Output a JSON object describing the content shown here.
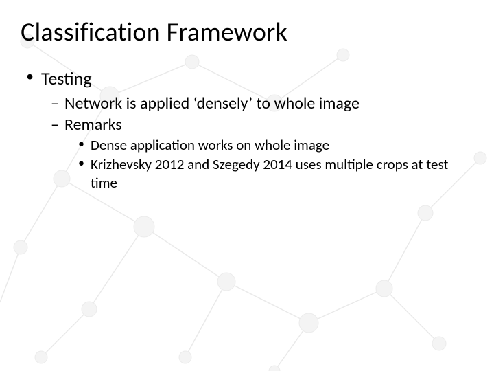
{
  "slide": {
    "title": "Classification Framework",
    "bullets": {
      "l1": "Testing",
      "l2a": "Network is applied ‘densely’ to whole image",
      "l2b": "Remarks",
      "l3a": "Dense application works on whole image",
      "l3b": "Krizhevsky 2012 and Szegedy 2014 uses multiple crops at test time"
    }
  }
}
